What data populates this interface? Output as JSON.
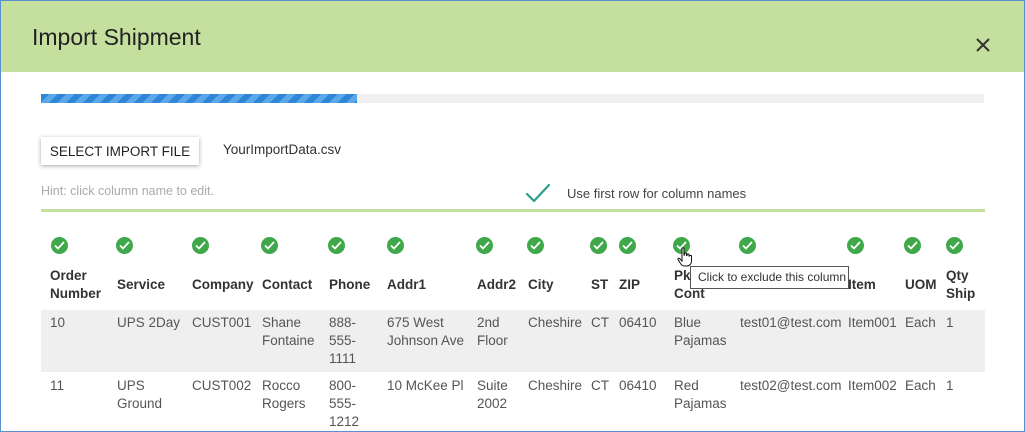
{
  "dialog": {
    "title": "Import Shipment",
    "close_icon": "close-icon"
  },
  "progress": {
    "value": 0.335
  },
  "select_button": {
    "label": "SELECT IMPORT FILE"
  },
  "file": {
    "name": "YourImportData.csv"
  },
  "hint": {
    "text": "Hint: click column name to edit."
  },
  "first_row": {
    "label": "Use first row for column names",
    "checked": true
  },
  "columns": [
    {
      "label": "Order Number",
      "line1": "Order",
      "line2": "Number"
    },
    {
      "label": "Service"
    },
    {
      "label": "Company"
    },
    {
      "label": "Contact"
    },
    {
      "label": "Phone"
    },
    {
      "label": "Addr1"
    },
    {
      "label": "Addr2"
    },
    {
      "label": "City"
    },
    {
      "label": "ST"
    },
    {
      "label": "ZIP"
    },
    {
      "label": "Pk Cont",
      "line1": "Pk",
      "line2": "Cont"
    },
    {
      "label": ""
    },
    {
      "label": "Item"
    },
    {
      "label": "UOM"
    },
    {
      "label": "Qty Ship",
      "line1": "Qty",
      "line2": "Ship"
    }
  ],
  "rows": [
    [
      "10",
      "UPS 2Day",
      "CUST001",
      "Shane Fontaine",
      "888-555-1111",
      "675 West Johnson Ave",
      "2nd Floor",
      "Cheshire",
      "CT",
      "06410",
      "Blue Pajamas",
      "test01@test.com",
      "Item001",
      "Each",
      "1"
    ],
    [
      "11",
      "UPS Ground",
      "CUST002",
      "Rocco Rogers",
      "800-555-1212",
      "10 McKee Pl",
      "Suite 2002",
      "Cheshire",
      "CT",
      "06410",
      "Red Pajamas",
      "test02@test.com",
      "Item002",
      "Each",
      "1"
    ]
  ],
  "row_lines": [
    [
      [
        "10"
      ],
      [
        "UPS 2Day"
      ],
      [
        "CUST001"
      ],
      [
        "Shane",
        "Fontaine"
      ],
      [
        "888-",
        "555-",
        "1111"
      ],
      [
        "675 West",
        "Johnson Ave"
      ],
      [
        "2nd",
        "Floor"
      ],
      [
        "Cheshire"
      ],
      [
        "CT"
      ],
      [
        "06410"
      ],
      [
        "Blue",
        "Pajamas"
      ],
      [
        "test01@test.com"
      ],
      [
        "Item001"
      ],
      [
        "Each"
      ],
      [
        "1"
      ]
    ],
    [
      [
        "11"
      ],
      [
        "UPS",
        "Ground"
      ],
      [
        "CUST002"
      ],
      [
        "Rocco",
        "Rogers"
      ],
      [
        "800-",
        "555-",
        "1212"
      ],
      [
        "10 McKee Pl"
      ],
      [
        "Suite",
        "2002"
      ],
      [
        "Cheshire"
      ],
      [
        "CT"
      ],
      [
        "06410"
      ],
      [
        "Red",
        "Pajamas"
      ],
      [
        "test02@test.com"
      ],
      [
        "Item002"
      ],
      [
        "Each"
      ],
      [
        "1"
      ]
    ]
  ],
  "tooltip": {
    "text": "Click to exclude this column"
  },
  "colors": {
    "header_bg": "#c5df9f",
    "check_green": "#3fa84a",
    "progress_blue": "#2f86d6",
    "teal_check": "#2a9d8f"
  }
}
